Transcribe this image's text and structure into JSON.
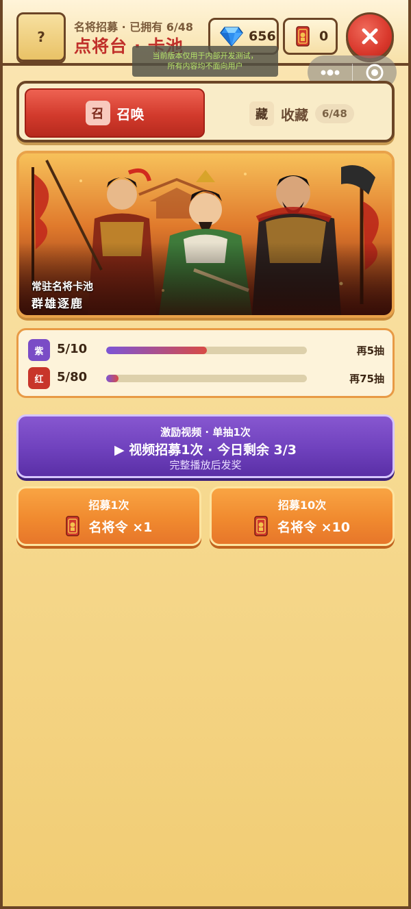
{
  "header": {
    "help_label": "?",
    "subtitle": "名将招募 · 已拥有 6/48",
    "title": "点将台 · 卡池",
    "gems": "656",
    "tokens": "0",
    "close_label": "✕"
  },
  "dev_notice": {
    "line1": "当前版本仅用于内部开发测试，",
    "line2": "所有内容均不面向用户"
  },
  "capsule": {
    "more_icon": "more-dots-icon",
    "close_icon": "target-circle-icon"
  },
  "tabs": {
    "summon": {
      "badge": "召",
      "label": "召唤"
    },
    "collection": {
      "badge": "藏",
      "label": "收藏",
      "count": "6/48"
    }
  },
  "banner": {
    "subtitle": "常驻名将卡池",
    "title": "群雄逐鹿"
  },
  "pity": [
    {
      "badge": "紫",
      "count": "5/10",
      "progress": 0.5,
      "remaining": "再5抽",
      "color": "#7a4cc6"
    },
    {
      "badge": "红",
      "count": "5/80",
      "progress": 0.0625,
      "remaining": "再75抽",
      "color": "#c8352a"
    }
  ],
  "video": {
    "top": "激励视频 · 单抽1次",
    "main": "▶ 视频招募1次 · 今日剩余 3/3",
    "bottom": "完整播放后发奖"
  },
  "recruit": {
    "one": {
      "title": "招募1次",
      "cost": "名将令 ×1"
    },
    "ten": {
      "title": "招募10次",
      "cost": "名将令 ×10"
    }
  },
  "colors": {
    "accent_red": "#c0302a",
    "border_brown": "#6b4526",
    "video_purple": "#6f41bd",
    "recruit_orange": "#f08a2f"
  }
}
